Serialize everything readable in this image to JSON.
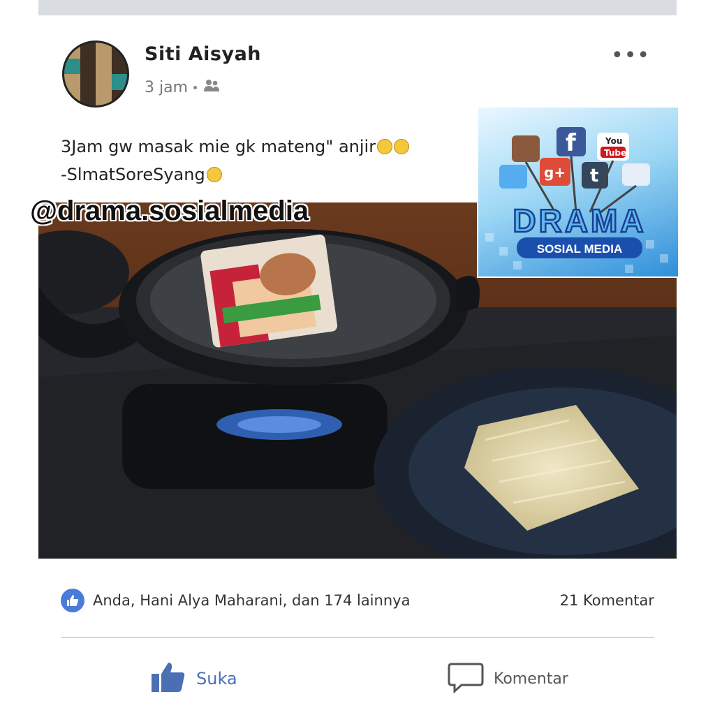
{
  "post": {
    "author": "Siti Aisyah",
    "time": "3 jam",
    "caption_line1": "3Jam gw masak mie gk mateng\" anjir",
    "caption_line2": "-SlmatSoreSyang",
    "more_label": "•••"
  },
  "watermark": "@drama.sosialmedia",
  "logo": {
    "title": "DRAMA",
    "subtitle": "SOSIAL MEDIA",
    "social_icons": [
      "instagram-icon",
      "facebook-icon",
      "youtube-icon",
      "twitter-icon",
      "google-plus-icon",
      "tumblr-icon",
      "like-icon"
    ]
  },
  "stats": {
    "likes_text": "Anda, Hani Alya Maharani, dan 174 lainnya",
    "comments_text": "21 Komentar"
  },
  "actions": {
    "like_label": "Suka",
    "comment_label": "Komentar"
  },
  "colors": {
    "facebook_blue": "#4b7bd9",
    "action_blue": "#4a6fb5"
  }
}
